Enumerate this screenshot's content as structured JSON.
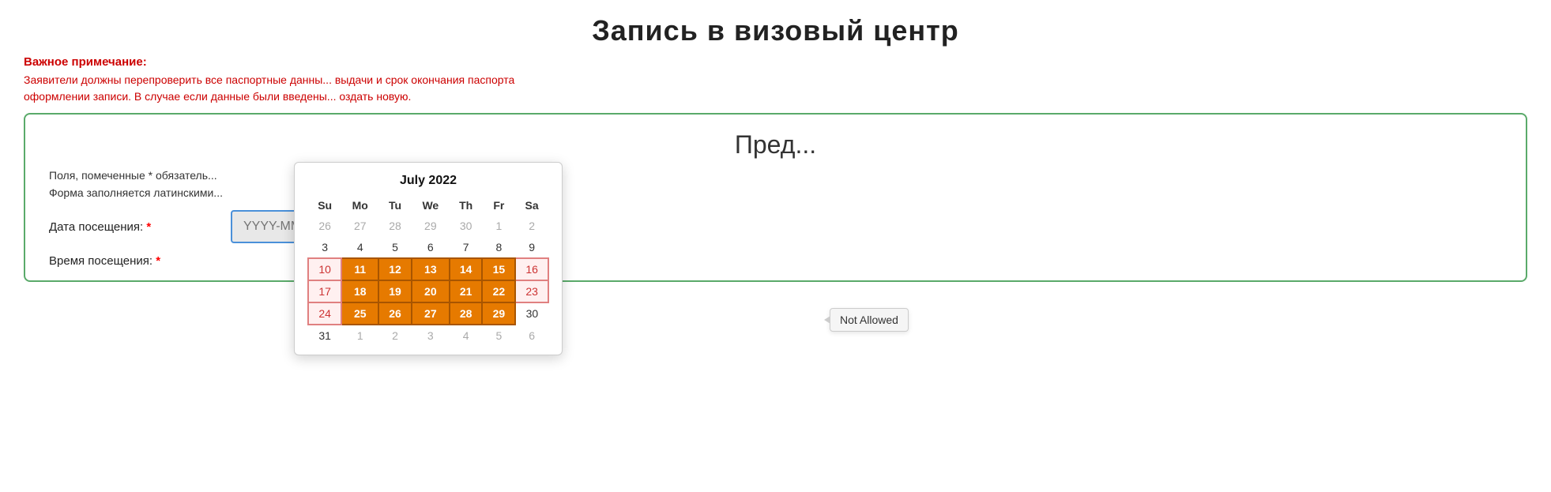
{
  "page": {
    "title": "Запись в визовый центр"
  },
  "notice": {
    "title": "Важное примечание:",
    "line1": "Заявители должны перепроверить все паспортные данны... выдачи и срок окончания паспорта",
    "line2": "оформлении записи. В случае если данные были введены... оздать новую."
  },
  "form": {
    "section_title": "Пред...",
    "note1": "Поля, помеченные * обязатель...",
    "note2": "Форма заполняется латинскими...",
    "date_label": "Дата посещения:",
    "date_asterisk": "*",
    "date_placeholder": "YYYY-MM-DD",
    "time_label": "Время посещения:",
    "time_asterisk": "*"
  },
  "calendar": {
    "title": "July 2022",
    "weekdays": [
      "Su",
      "Mo",
      "Tu",
      "We",
      "Th",
      "Fr",
      "Sa"
    ],
    "weeks": [
      [
        {
          "day": "26",
          "type": "prev-month"
        },
        {
          "day": "27",
          "type": "prev-month"
        },
        {
          "day": "28",
          "type": "prev-month"
        },
        {
          "day": "29",
          "type": "prev-month"
        },
        {
          "day": "30",
          "type": "prev-month"
        },
        {
          "day": "1",
          "type": "gray-day"
        },
        {
          "day": "2",
          "type": "gray-day"
        }
      ],
      [
        {
          "day": "3",
          "type": "current-month"
        },
        {
          "day": "4",
          "type": "current-month"
        },
        {
          "day": "5",
          "type": "current-month"
        },
        {
          "day": "6",
          "type": "current-month"
        },
        {
          "day": "7",
          "type": "current-month"
        },
        {
          "day": "8",
          "type": "current-month"
        },
        {
          "day": "9",
          "type": "current-month"
        }
      ],
      [
        {
          "day": "10",
          "type": "pink-day"
        },
        {
          "day": "11",
          "type": "orange-day"
        },
        {
          "day": "12",
          "type": "orange-day"
        },
        {
          "day": "13",
          "type": "orange-day"
        },
        {
          "day": "14",
          "type": "orange-day"
        },
        {
          "day": "15",
          "type": "orange-day"
        },
        {
          "day": "16",
          "type": "pink-day"
        }
      ],
      [
        {
          "day": "17",
          "type": "pink-day"
        },
        {
          "day": "18",
          "type": "orange-day"
        },
        {
          "day": "19",
          "type": "orange-day"
        },
        {
          "day": "20",
          "type": "orange-day"
        },
        {
          "day": "21",
          "type": "orange-day"
        },
        {
          "day": "22",
          "type": "orange-day"
        },
        {
          "day": "23",
          "type": "pink-day"
        }
      ],
      [
        {
          "day": "24",
          "type": "pink-day"
        },
        {
          "day": "25",
          "type": "orange-day"
        },
        {
          "day": "26",
          "type": "orange-day"
        },
        {
          "day": "27",
          "type": "orange-day"
        },
        {
          "day": "28",
          "type": "orange-day"
        },
        {
          "day": "29",
          "type": "orange-day"
        },
        {
          "day": "30",
          "type": "current-month"
        }
      ],
      [
        {
          "day": "31",
          "type": "current-month"
        },
        {
          "day": "1",
          "type": "next-month"
        },
        {
          "day": "2",
          "type": "next-month"
        },
        {
          "day": "3",
          "type": "next-month"
        },
        {
          "day": "4",
          "type": "next-month"
        },
        {
          "day": "5",
          "type": "next-month"
        },
        {
          "day": "6",
          "type": "next-month"
        }
      ]
    ]
  },
  "tooltip": {
    "not_allowed": "Not Allowed"
  }
}
